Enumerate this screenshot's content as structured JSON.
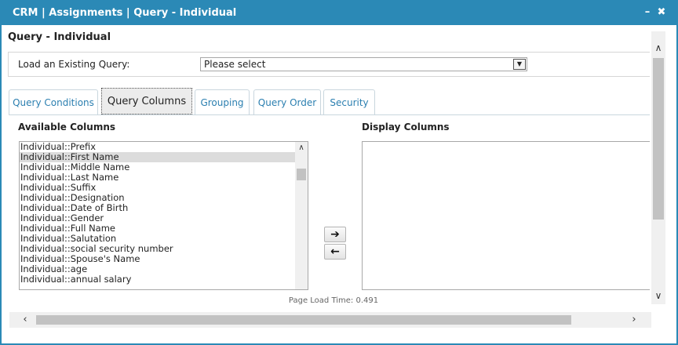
{
  "window": {
    "title": "CRM | Assignments | Query - Individual",
    "minimize_glyph": "–",
    "close_glyph": "✖"
  },
  "page": {
    "title": "Query - Individual",
    "load_label": "Load an Existing Query:",
    "load_select_value": "Please select",
    "load_time": "Page Load Time: 0.491"
  },
  "tabs": [
    {
      "label": "Query Conditions",
      "active": false
    },
    {
      "label": "Query Columns",
      "active": true
    },
    {
      "label": "Grouping",
      "active": false
    },
    {
      "label": "Query Order",
      "active": false
    },
    {
      "label": "Security",
      "active": false
    }
  ],
  "columns": {
    "available_title": "Available Columns",
    "display_title": "Display Columns",
    "available_items": [
      "Individual::Prefix",
      "Individual::First Name",
      "Individual::Middle Name",
      "Individual::Last Name",
      "Individual::Suffix",
      "Individual::Designation",
      "Individual::Date of Birth",
      "Individual::Gender",
      "Individual::Full Name",
      "Individual::Salutation",
      "Individual::social security number",
      "Individual::Spouse's Name",
      "Individual::age",
      "Individual::annual salary"
    ],
    "selected_item": "Individual::First Name",
    "move_right_glyph": "➔",
    "move_left_glyph": "←"
  },
  "icons": {
    "chevron_up": "∧",
    "chevron_down": "∨",
    "chevron_left": "‹",
    "chevron_right": "›",
    "select_arrow": "▼"
  },
  "colors": {
    "titlebar": "#2b89b6",
    "tab_link": "#2b7fb0"
  }
}
